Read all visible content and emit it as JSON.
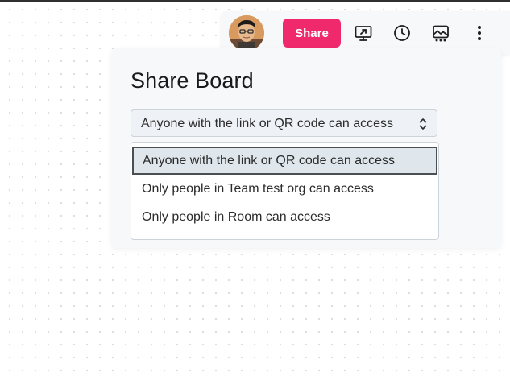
{
  "toolbar": {
    "share_label": "Share",
    "icons": [
      "present-screen-icon",
      "history-clock-icon",
      "image-gallery-icon",
      "more-vertical-icon"
    ]
  },
  "share_panel": {
    "title": "Share Board",
    "access_select": {
      "selected": "Anyone with the link or QR code can access",
      "options": [
        "Anyone with the link or QR code can access",
        "Only people in Team test org can access",
        "Only people in Room can access"
      ]
    }
  },
  "colors": {
    "share_button": "#f0286c",
    "panel_background": "#f7f8fa",
    "selected_option_background": "#dfe7ec"
  }
}
